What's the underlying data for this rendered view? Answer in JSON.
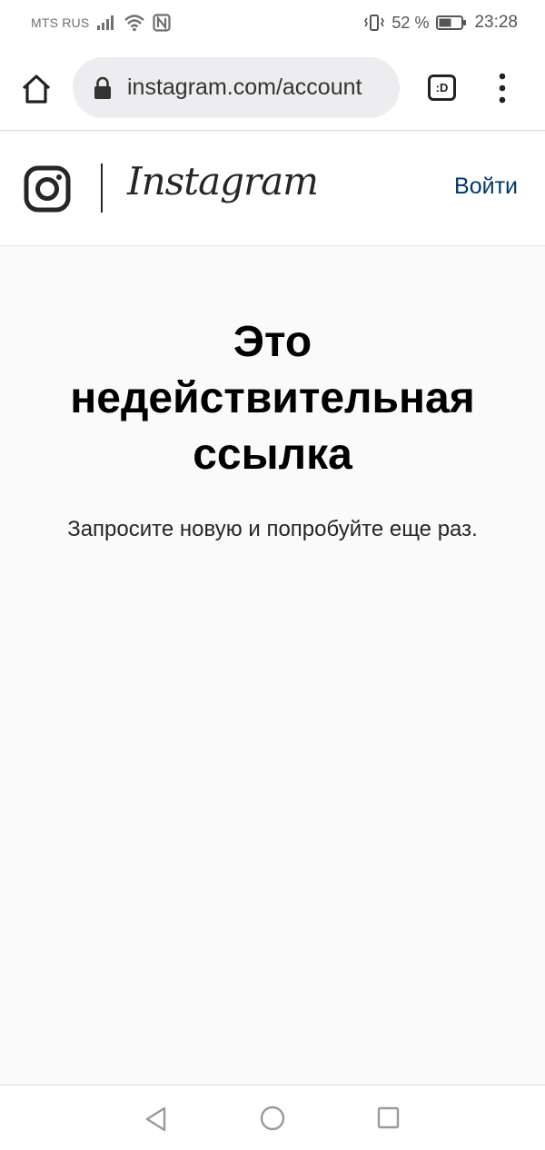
{
  "status_bar": {
    "carrier": "MTS RUS",
    "battery_percent": "52 %",
    "time": "23:28",
    "icons": [
      "signal-icon",
      "wifi-icon",
      "nfc-icon",
      "vibrate-icon",
      "battery-icon"
    ]
  },
  "browser": {
    "url": "instagram.com/account",
    "tabs_label": ":D",
    "icons": [
      "home-icon",
      "lock-icon",
      "tabs-icon",
      "more-vert-icon"
    ]
  },
  "header": {
    "wordmark": "Instagram",
    "login_label": "Войти",
    "link_color": "#00376b"
  },
  "error": {
    "title": "Это недействительная ссылка",
    "subtitle": "Запросите новую и попробуйте еще раз."
  },
  "system_nav": {
    "icons": [
      "back-icon",
      "home-circle-icon",
      "recents-icon"
    ]
  }
}
